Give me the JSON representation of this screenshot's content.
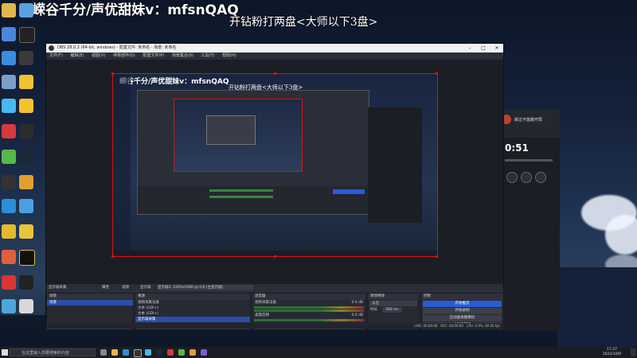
{
  "stream_overlay": {
    "title": "嵘谷千分/声优甜妹v：mfsnQAQ",
    "subtitle": "开钻粉打两盘<大师以下3盘>"
  },
  "obs": {
    "window_title": "OBS 28.0.2 (64-bit, windows) - 配置文件: 未命名 - 场景: 未命名",
    "menu": [
      "文件(F)",
      "编辑(E)",
      "视图(V)",
      "停靠部件(D)",
      "配置文件(P)",
      "场景集合(S)",
      "工具(T)",
      "帮助(H)"
    ],
    "scene_bar": {
      "selected_source": "显示器采集",
      "properties": "属性",
      "filters": "滤镜",
      "display": "显示器",
      "display_value": "显示器1: 1920x1080 @ 0,0 (主显示器)"
    },
    "docks": {
      "scenes": {
        "title": "场景",
        "items": [
          "场景"
        ]
      },
      "sources": {
        "title": "来源",
        "items": [
          "视频采集设备",
          "文本 (GDI+)",
          "文本 (GDI+)",
          "显示器采集"
        ]
      },
      "mixer": {
        "title": "混音器",
        "channels": [
          {
            "name": "视频采集设备",
            "level": "0.0 dB"
          },
          {
            "name": "桌面音频",
            "level": "0.0 dB"
          }
        ]
      },
      "transitions": {
        "title": "转场特效",
        "type": "淡出",
        "duration_label": "时长",
        "duration": "300 ms"
      },
      "controls": {
        "title": "控制",
        "buttons": [
          "开始推流",
          "开始录制",
          "启动虚拟摄像机",
          "工作室模式",
          "设置",
          "退出"
        ]
      }
    },
    "status": {
      "live": "LIVE: 00:00:00",
      "rec": "REC: 00:00:00",
      "cpu": "CPU: 0.9%, 60.00 fps"
    }
  },
  "game": {
    "match_label": "跳过不能跳开局",
    "timer": "0:51"
  },
  "taskbar": {
    "search_placeholder": "在这里输入你要搜索的内容",
    "time": "17:37",
    "date": "2022/10/9"
  },
  "desktop_icons": [
    "回收站",
    "此电脑",
    "Microsoft Edge",
    "控制面板",
    "QQ",
    "网易云音乐",
    "Steam",
    "GeForce",
    "OBS Studio",
    "英雄联盟",
    "WeGame",
    "网易UU",
    "腾讯会议",
    "YY语音"
  ]
}
